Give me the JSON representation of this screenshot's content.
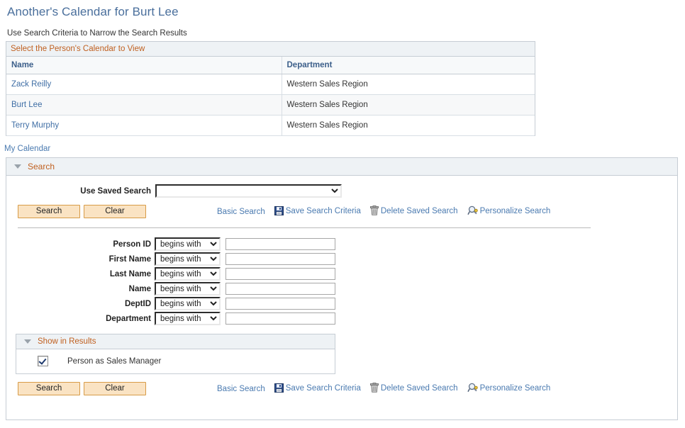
{
  "page": {
    "title": "Another's Calendar for Burt Lee",
    "instruction": "Use Search Criteria to Narrow the Search Results"
  },
  "grid": {
    "caption": "Select the Person's Calendar to View",
    "columns": [
      "Name",
      "Department"
    ],
    "rows": [
      {
        "name": "Zack Reilly",
        "department": "Western Sales Region"
      },
      {
        "name": "Burt Lee",
        "department": "Western Sales Region"
      },
      {
        "name": "Terry Murphy",
        "department": "Western Sales Region"
      }
    ]
  },
  "my_calendar_link": "My Calendar",
  "search_panel": {
    "header": "Search",
    "saved_search": {
      "label": "Use Saved Search",
      "value": "",
      "options": [
        ""
      ]
    },
    "buttons": {
      "search": "Search",
      "clear": "Clear"
    },
    "links": {
      "basic_search": "Basic Search",
      "save_search_criteria": "Save Search Criteria",
      "delete_saved_search": "Delete Saved Search",
      "personalize_search": "Personalize Search"
    },
    "icons": {
      "save": "floppy-disk-icon",
      "delete": "trash-can-icon",
      "personalize": "magnifier-wrench-icon",
      "collapse": "triangle-down-icon"
    },
    "criteria": {
      "operator_options": [
        "begins with"
      ],
      "operator_selected": "begins with",
      "fields": [
        {
          "label": "Person ID",
          "operator": "begins with",
          "value": ""
        },
        {
          "label": "First Name",
          "operator": "begins with",
          "value": ""
        },
        {
          "label": "Last Name",
          "operator": "begins with",
          "value": ""
        },
        {
          "label": "Name",
          "operator": "begins with",
          "value": ""
        },
        {
          "label": "DeptID",
          "operator": "begins with",
          "value": ""
        },
        {
          "label": "Department",
          "operator": "begins with",
          "value": ""
        }
      ]
    },
    "show_in_results": {
      "header": "Show in Results",
      "checkbox_label": "Person as Sales Manager",
      "checked": true
    }
  },
  "colors": {
    "title_blue": "#4a6f9c",
    "section_orange": "#c06020",
    "link_blue": "#4a7ab0",
    "header_blue": "#3c5f8a",
    "button_face": "#fae3c3",
    "button_border": "#d79b47",
    "panel_header_bg": "#eef2f5",
    "border_gray": "#c6cdd4"
  }
}
